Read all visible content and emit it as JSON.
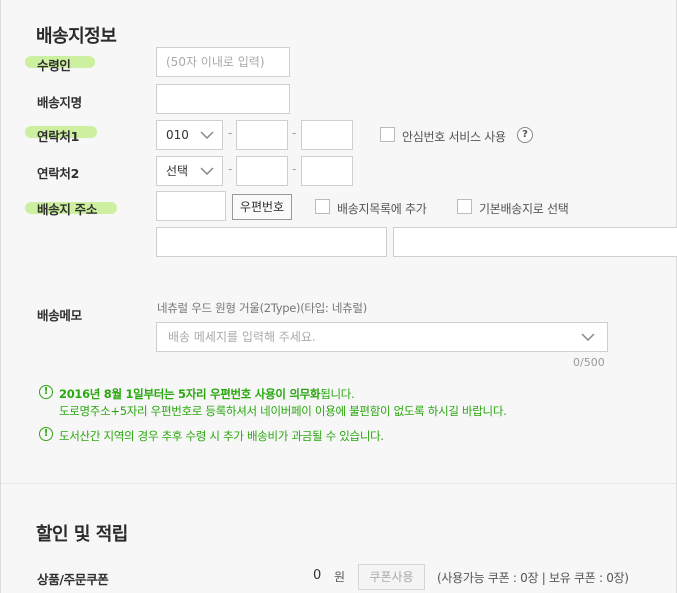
{
  "delivery": {
    "title": "배송지정보",
    "recipient": {
      "label": "수령인",
      "placeholder": "(50자 이내로 입력)"
    },
    "address_name": {
      "label": "배송지명"
    },
    "contact1": {
      "label": "연락처1",
      "prefix": "010",
      "safe_number_label": "안심번호 서비스 사용",
      "help": "?"
    },
    "contact2": {
      "label": "연락처2",
      "prefix": "선택"
    },
    "address": {
      "label": "배송지 주소",
      "postcode_button": "우편번호",
      "add_to_list_label": "배송지목록에 추가",
      "default_label": "기본배송지로 선택"
    },
    "memo": {
      "label": "배송메모",
      "hint": "네츄럴 우드 원형 거울(2Type)(타입: 네츄럴)",
      "placeholder": "배송 메세지를 입력해 주세요.",
      "counter": "0/500"
    },
    "notices": {
      "notice1_highlight": "2016년 8월 1일부터는 5자리 우편번호 사용이 의무화",
      "notice1_rest": "됩니다.",
      "notice1_line2": "도로명주소+5자리 우편번호로 등록하셔서 네이버페이 이용에 불편함이 없도록 하시길 바랍니다.",
      "notice2": "도서산간 지역의 경우 추후 수령 시 추가 배송비가 과금될 수 있습니다.",
      "icon": "!"
    }
  },
  "discount": {
    "title": "할인 및 적립",
    "coupon_label": "상품/주문쿠폰",
    "amount": "0",
    "unit": "원",
    "coupon_button": "쿠폰사용",
    "coupon_info": "(사용가능 쿠폰 : 0장 | 보유 쿠폰 : 0장)"
  },
  "colors": {
    "highlight": "#c9ef9a",
    "notice_green": "#2aa70f"
  }
}
